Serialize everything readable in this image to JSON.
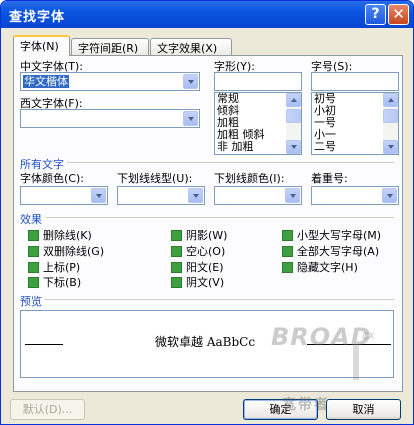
{
  "window": {
    "title": "查找字体",
    "help_symbol": "?",
    "close_symbol": "✕"
  },
  "tabs": [
    {
      "label": "字体(N)",
      "active": true
    },
    {
      "label": "字符间距(R)",
      "active": false
    },
    {
      "label": "文字效果(X)",
      "active": false
    }
  ],
  "font": {
    "chinese_label": "中文字体(T):",
    "chinese_value": "华文楷体",
    "western_label": "西文字体(F):",
    "western_value": "",
    "style_label": "字形(Y):",
    "style_value": "",
    "style_items": [
      "常规",
      "倾斜",
      "加粗",
      "加粗 倾斜",
      "非 加粗"
    ],
    "size_label": "字号(S):",
    "size_value": "",
    "size_items": [
      "初号",
      "小初",
      "一号",
      "小一",
      "二号"
    ]
  },
  "all_text": {
    "section_label": "所有文字",
    "color_label": "字体颜色(C):",
    "underline_type_label": "下划线线型(U):",
    "underline_color_label": "下划线颜色(I):",
    "emphasis_label": "着重号:"
  },
  "effects": {
    "section_label": "效果",
    "items": [
      {
        "label": "删除线(K)",
        "filled": true
      },
      {
        "label": "双删除线(G)",
        "filled": true
      },
      {
        "label": "上标(P)",
        "filled": true
      },
      {
        "label": "下标(B)",
        "filled": true
      },
      {
        "label": "阴影(W)",
        "filled": true
      },
      {
        "label": "空心(O)",
        "filled": true
      },
      {
        "label": "阳文(E)",
        "filled": true
      },
      {
        "label": "阴文(V)",
        "filled": true
      },
      {
        "label": "小型大写字母(M)",
        "filled": true
      },
      {
        "label": "全部大写字母(A)",
        "filled": true
      },
      {
        "label": "隐藏文字(H)",
        "filled": true
      }
    ]
  },
  "preview": {
    "section_label": "预览",
    "sample_text": "微软卓越 AaBbCc"
  },
  "watermark": {
    "brand": "BROAD",
    "superscript": "CX",
    "tagline": "宽带者"
  },
  "buttons": {
    "default_label": "默认(D)...",
    "ok_label": "确定",
    "cancel_label": "取消"
  }
}
